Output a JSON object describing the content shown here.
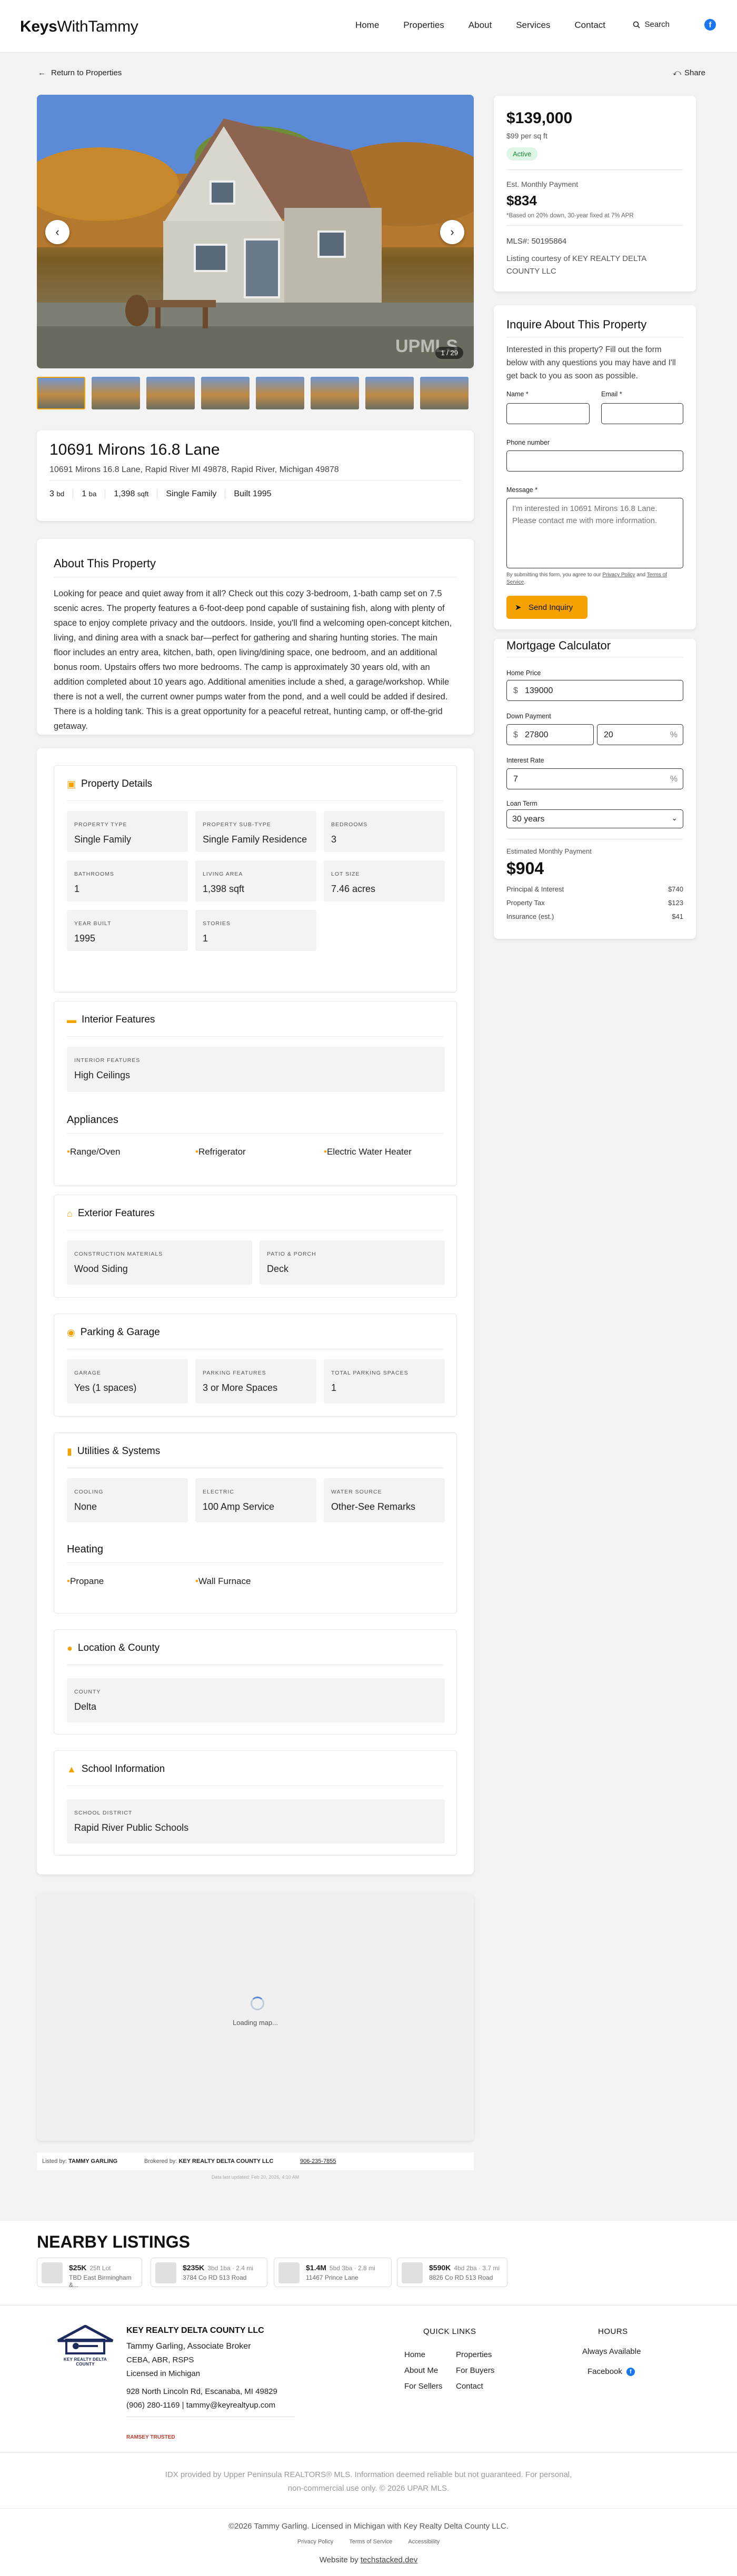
{
  "brand": {
    "name_a": "Keys",
    "name_b": "WithTammy"
  },
  "nav": [
    "Home",
    "Properties",
    "About",
    "Services",
    "Contact"
  ],
  "search_label": "Search",
  "facebook_glyph": "f",
  "back_label": "Return to Properties",
  "share_label": "Share",
  "gallery": {
    "counter": "1 / 29",
    "watermark": "UPMLS"
  },
  "property": {
    "title": "10691 Mirons 16.8 Lane",
    "address": "10691 Mirons 16.8 Lane, Rapid River MI 49878, Rapid River, Michigan 49878",
    "beds_num": "3",
    "beds_unit": "bd",
    "baths_num": "1",
    "baths_unit": "ba",
    "sqft_num": "1,398",
    "sqft_unit": "sqft",
    "type": "Single Family",
    "built": "Built 1995"
  },
  "about": {
    "heading": "About This Property",
    "text": "Looking for peace and quiet away from it all? Check out this cozy 3-bedroom, 1-bath camp set on 7.5 scenic acres. The property features a 6-foot-deep pond capable of sustaining fish, along with plenty of space to enjoy complete privacy and the outdoors. Inside, you'll find a welcoming open-concept kitchen, living, and dining area with a snack bar—perfect for gathering and sharing hunting stories. The main floor includes an entry area, kitchen, bath, open living/dining space, one bedroom, and an additional bonus room. Upstairs offers two more bedrooms. The camp is approximately 30 years old, with an addition completed about 10 years ago. Additional amenities include a shed, a garage/workshop. While there is not a well, the current owner pumps water from the pond, and a well could be added if desired. There is a holding tank. This is a great opportunity for a peaceful retreat, hunting camp, or off-the-grid getaway."
  },
  "details": {
    "heading": "Property Details",
    "cells": [
      {
        "label": "PROPERTY TYPE",
        "value": "Single Family"
      },
      {
        "label": "PROPERTY SUB-TYPE",
        "value": "Single Family Residence"
      },
      {
        "label": "BEDROOMS",
        "value": "3"
      },
      {
        "label": "BATHROOMS",
        "value": "1"
      },
      {
        "label": "LIVING AREA",
        "value": "1,398 sqft"
      },
      {
        "label": "LOT SIZE",
        "value": "7.46 acres"
      },
      {
        "label": "YEAR BUILT",
        "value": "1995"
      },
      {
        "label": "STORIES",
        "value": "1"
      }
    ]
  },
  "interior": {
    "heading": "Interior Features",
    "cell_label": "INTERIOR FEATURES",
    "cell_value": "High Ceilings",
    "appliances_heading": "Appliances",
    "appliances": [
      "Range/Oven",
      "Refrigerator",
      "Electric Water Heater"
    ]
  },
  "exterior": {
    "heading": "Exterior Features",
    "cells": [
      {
        "label": "CONSTRUCTION MATERIALS",
        "value": "Wood Siding"
      },
      {
        "label": "PATIO & PORCH",
        "value": "Deck"
      }
    ]
  },
  "parking": {
    "heading": "Parking & Garage",
    "cells": [
      {
        "label": "GARAGE",
        "value": "Yes (1 spaces)"
      },
      {
        "label": "PARKING FEATURES",
        "value": "3 or More Spaces"
      },
      {
        "label": "TOTAL PARKING SPACES",
        "value": "1"
      }
    ]
  },
  "utilities": {
    "heading": "Utilities & Systems",
    "cells": [
      {
        "label": "COOLING",
        "value": "None"
      },
      {
        "label": "ELECTRIC",
        "value": "100 Amp Service"
      },
      {
        "label": "WATER SOURCE",
        "value": "Other-See Remarks"
      }
    ],
    "heating_heading": "Heating",
    "heating": [
      "Propane",
      "Wall Furnace"
    ]
  },
  "location": {
    "heading": "Location & County",
    "cell_label": "COUNTY",
    "cell_value": "Delta"
  },
  "school": {
    "heading": "School Information",
    "cell_label": "SCHOOL DISTRICT",
    "cell_value": "Rapid River Public Schools"
  },
  "map": {
    "loading": "Loading map..."
  },
  "listed_by": {
    "listed_label": "Listed by:",
    "listed_name": "TAMMY GARLING",
    "brokered_label": "Brokered by:",
    "brokered_name": "KEY REALTY DELTA COUNTY LLC",
    "phone": "906-235-7855",
    "updated": "Data last updated: Feb 20, 2026, 4:10 AM"
  },
  "price_card": {
    "price": "$139,000",
    "per_sqft": "$99 per sq ft",
    "status": "Active",
    "est_label": "Est. Monthly Payment",
    "est_value": "$834",
    "est_note": "*Based on 20% down, 30-year fixed at 7% APR",
    "mls": "MLS#: 50195864",
    "courtesy": "Listing courtesy of KEY REALTY DELTA COUNTY LLC"
  },
  "inquiry": {
    "heading": "Inquire About This Property",
    "intro": "Interested in this property? Fill out the form below with any questions you may have and I'll get back to you as soon as possible.",
    "name_label": "Name *",
    "email_label": "Email *",
    "phone_label": "Phone number",
    "message_label": "Message *",
    "message_placeholder": "I'm interested in 10691 Mirons 16.8 Lane. Please contact me with more information.",
    "consent_a": "By submitting this form, you agree to our ",
    "privacy": "Privacy Policy",
    "and": " and ",
    "terms": "Terms of Service",
    "consent_b": ".",
    "send": "Send Inquiry"
  },
  "mortgage": {
    "heading": "Mortgage Calculator",
    "home_price_label": "Home Price",
    "home_price": "139000",
    "down_label": "Down Payment",
    "down_amount": "27800",
    "down_pct": "20",
    "rate_label": "Interest Rate",
    "rate": "7",
    "term_label": "Loan Term",
    "term": "30 years",
    "est_label": "Estimated Monthly Payment",
    "est": "$904",
    "rows": [
      {
        "label": "Principal & Interest",
        "value": "$740"
      },
      {
        "label": "Property Tax",
        "value": "$123"
      },
      {
        "label": "Insurance (est.)",
        "value": "$41"
      }
    ],
    "currency": "$",
    "pct": "%"
  },
  "nearby": {
    "heading": "NEARBY LISTINGS",
    "items": [
      {
        "price": "$25K",
        "meta": "25ft Lot",
        "addr": "TBD East Birmingham &..."
      },
      {
        "price": "$235K",
        "meta": "3bd 1ba · 2.4 mi",
        "addr": "3784 Co RD 513 Road"
      },
      {
        "price": "$1.4M",
        "meta": "5bd 3ba · 2.8 mi",
        "addr": "11467 Prince Lane"
      },
      {
        "price": "$590K",
        "meta": "4bd 2ba · 3.7 mi",
        "addr": "8826 Co RD 513 Road"
      }
    ]
  },
  "footer": {
    "logo_text": "KEY REALTY DELTA COUNTY",
    "company": "KEY REALTY DELTA COUNTY LLC",
    "agent": "Tammy Garling, Associate Broker",
    "creds": "CEBA, ABR, RSPS",
    "license": "Licensed in Michigan",
    "address": "928 North Lincoln Rd, Escanaba, MI 49829",
    "contact": "(906) 280-1169 | tammy@keyrealtyup.com",
    "ramsey": "RAMSEY TRUSTED",
    "quick_heading": "QUICK LINKS",
    "links_a": [
      "Home",
      "About Me",
      "For Sellers"
    ],
    "links_b": [
      "Properties",
      "For Buyers",
      "Contact"
    ],
    "hours_heading": "HOURS",
    "hours": "Always Available",
    "facebook": "Facebook",
    "idx": "IDX provided by Upper Peninsula REALTORS® MLS. Information deemed reliable but not guaranteed. For personal, non-commercial use only. © 2026 UPAR MLS.",
    "copyright": "©2026 Tammy Garling. Licensed in Michigan with Key Realty Delta County LLC.",
    "legal": [
      "Privacy Policy",
      "Terms of Service",
      "Accessibility"
    ],
    "website_by": "Website by ",
    "dev": "techstacked.dev"
  }
}
